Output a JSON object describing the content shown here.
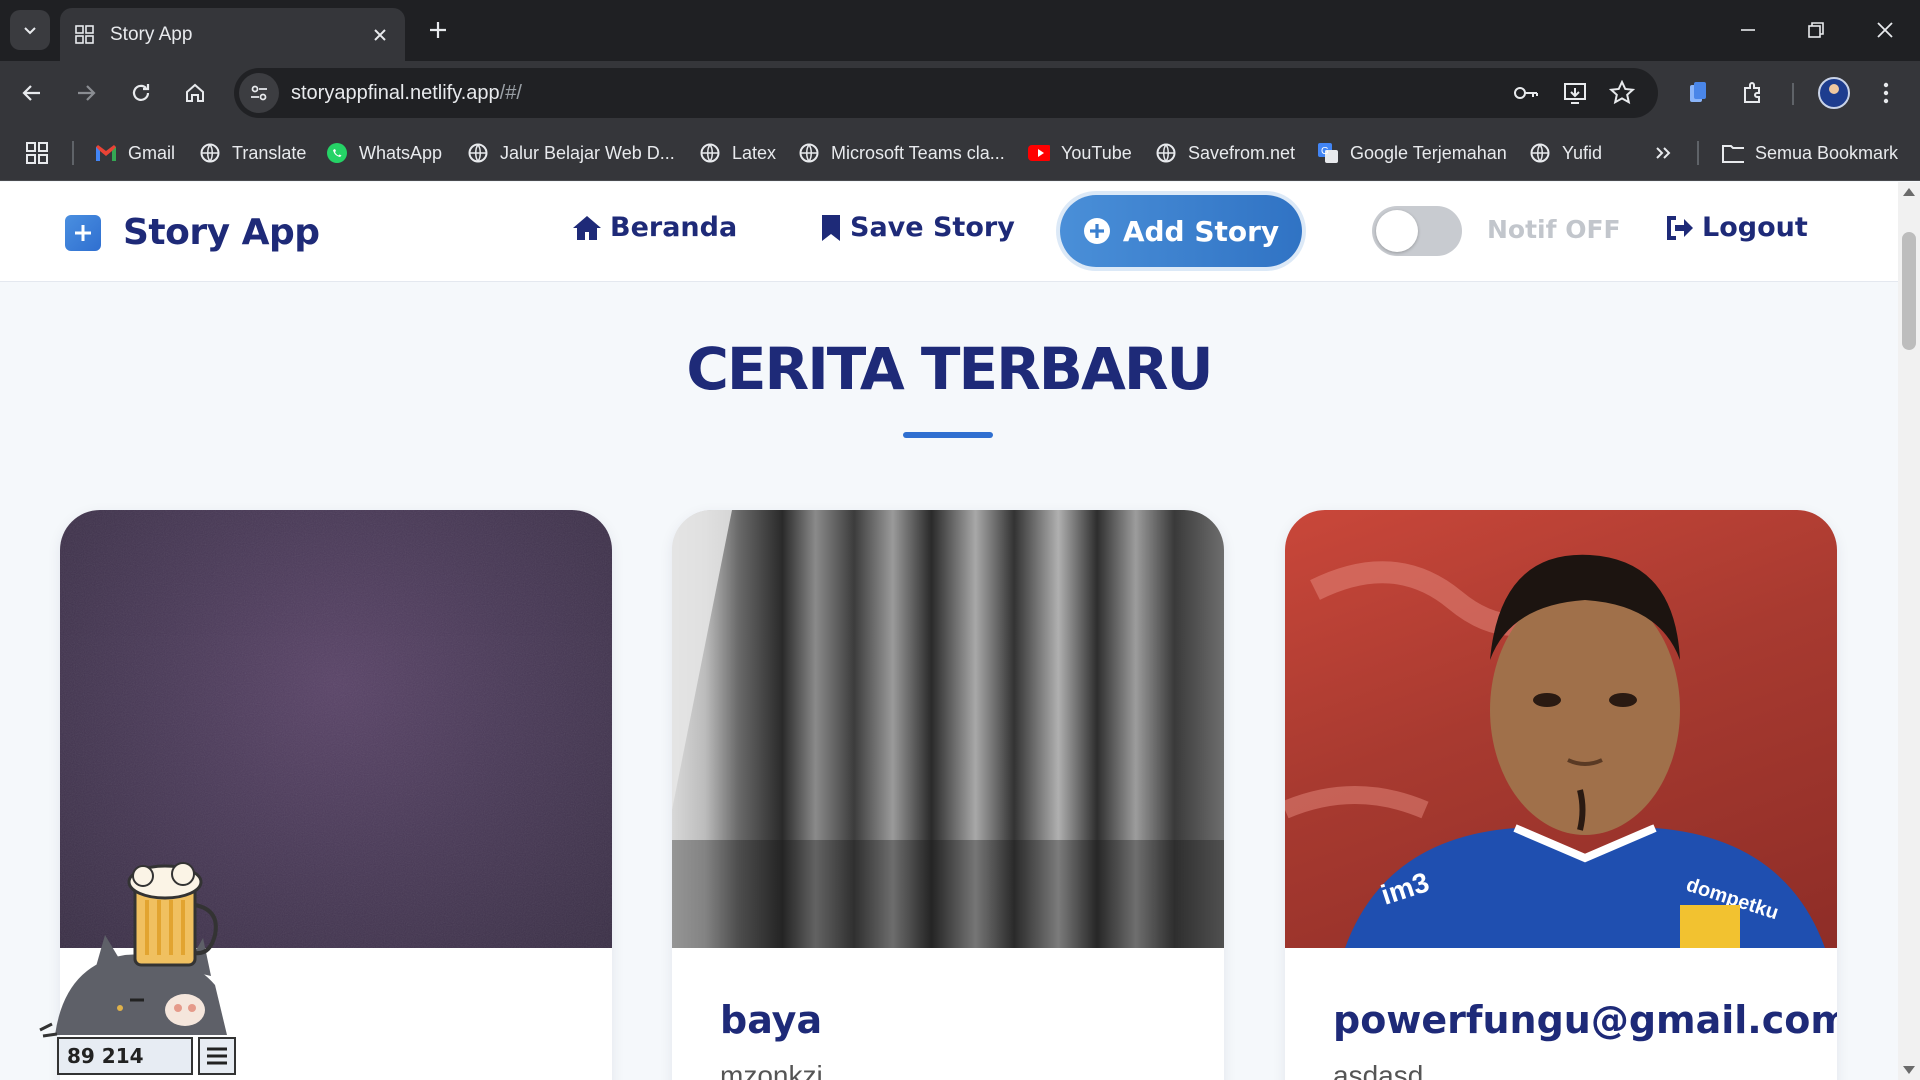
{
  "browser": {
    "tab_title": "Story App",
    "url_host": "storyappfinal.netlify.app",
    "url_path": "/#/",
    "bookmarks": [
      {
        "label": "Gmail",
        "icon": "gmail-icon"
      },
      {
        "label": "Translate",
        "icon": "globe-icon"
      },
      {
        "label": "WhatsApp",
        "icon": "whatsapp-icon"
      },
      {
        "label": "Jalur Belajar Web D...",
        "icon": "globe-icon"
      },
      {
        "label": "Latex",
        "icon": "globe-icon"
      },
      {
        "label": "Microsoft Teams cla...",
        "icon": "globe-icon"
      },
      {
        "label": "YouTube",
        "icon": "youtube-icon"
      },
      {
        "label": "Savefrom.net",
        "icon": "globe-icon"
      },
      {
        "label": "Google Terjemahan",
        "icon": "google-translate-icon"
      },
      {
        "label": "Yufid",
        "icon": "globe-icon"
      }
    ],
    "all_bookmarks_label": "Semua Bookmark"
  },
  "app": {
    "brand": "Story App",
    "nav": {
      "home": "Beranda",
      "saved": "Save Story",
      "add": "Add Story",
      "notif": "Notif OFF",
      "logout": "Logout"
    },
    "notif_enabled": false,
    "accent": "#2f6fd0",
    "text_dark": "#1e2a78"
  },
  "main": {
    "section_title": "CERITA TERBARU",
    "stories": [
      {
        "name": "",
        "description": ""
      },
      {
        "name": "baya",
        "description": "mzonkzi"
      },
      {
        "name": "powerfungu@gmail.com",
        "description": "asdasd"
      }
    ]
  },
  "widget": {
    "counter": "89 214"
  }
}
